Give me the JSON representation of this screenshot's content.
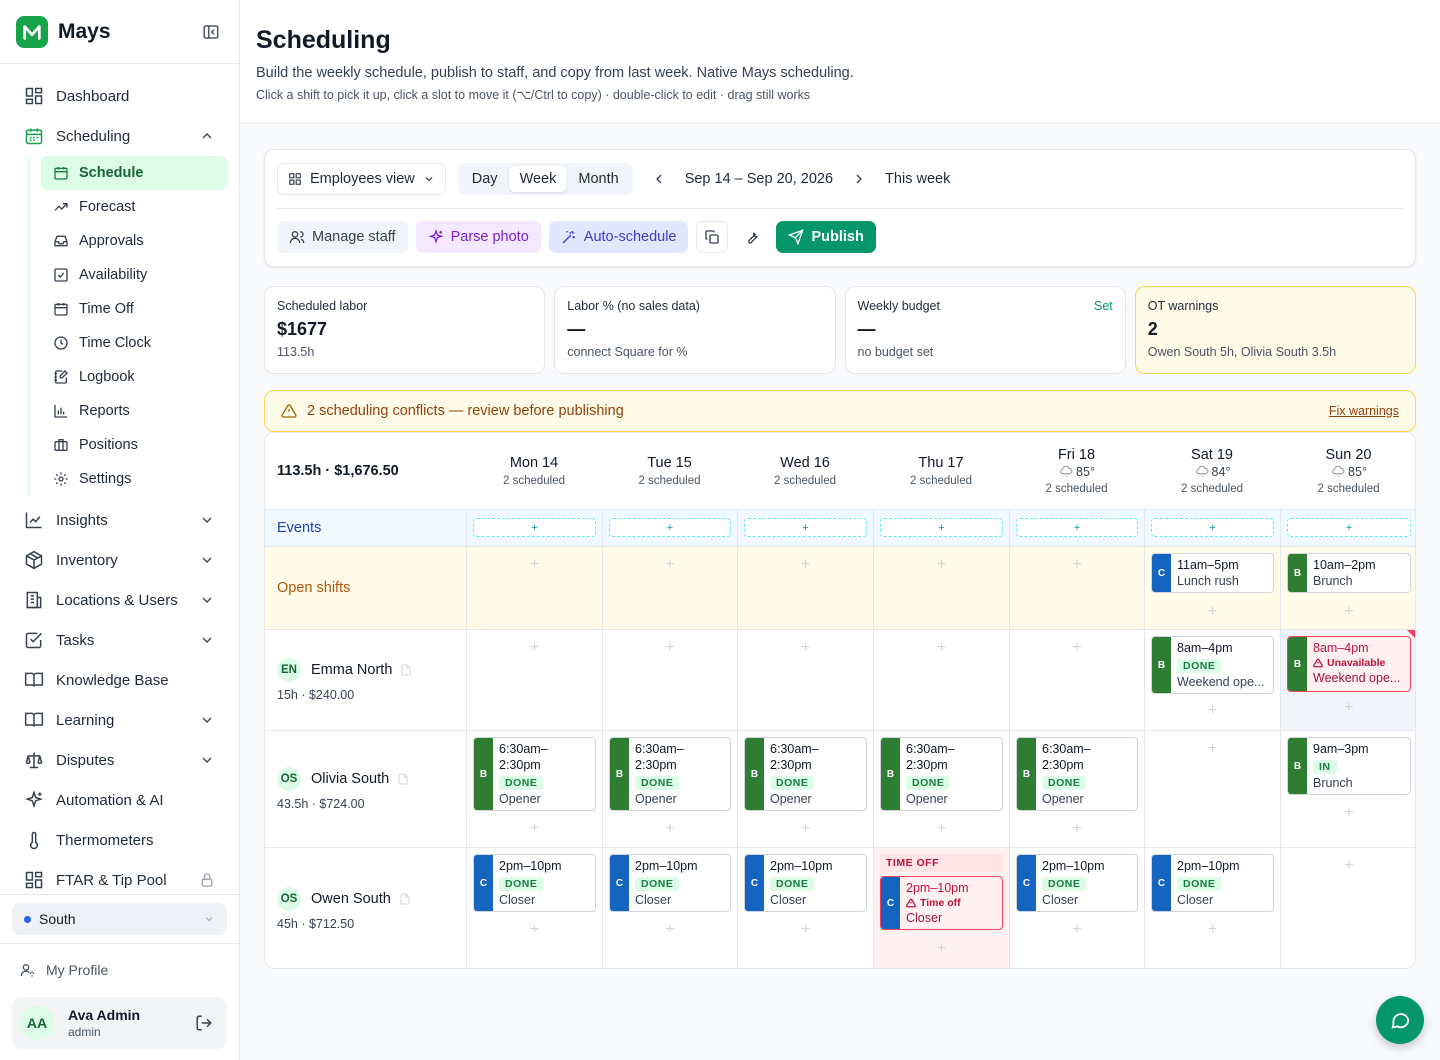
{
  "app": {
    "name": "Mays"
  },
  "sidebar": {
    "items": [
      {
        "label": "Dashboard"
      },
      {
        "label": "Scheduling"
      },
      {
        "label": "Insights"
      },
      {
        "label": "Inventory"
      },
      {
        "label": "Locations & Users"
      },
      {
        "label": "Tasks"
      },
      {
        "label": "Knowledge Base"
      },
      {
        "label": "Learning"
      },
      {
        "label": "Disputes"
      },
      {
        "label": "Automation & AI"
      },
      {
        "label": "Thermometers"
      },
      {
        "label": "FTAR & Tip Pool"
      }
    ],
    "scheduling_sub": [
      {
        "label": "Schedule"
      },
      {
        "label": "Forecast"
      },
      {
        "label": "Approvals"
      },
      {
        "label": "Availability"
      },
      {
        "label": "Time Off"
      },
      {
        "label": "Time Clock"
      },
      {
        "label": "Logbook"
      },
      {
        "label": "Reports"
      },
      {
        "label": "Positions"
      },
      {
        "label": "Settings"
      }
    ],
    "location": "South",
    "my_profile": "My Profile",
    "user": {
      "initials": "AA",
      "name": "Ava Admin",
      "role": "admin"
    }
  },
  "header": {
    "title": "Scheduling",
    "subtitle": "Build the weekly schedule, publish to staff, and copy from last week. Native Mays scheduling.",
    "hint": "Click a shift to pick it up, click a slot to move it (⌥/Ctrl to copy) · double-click to edit · drag still works"
  },
  "toolbar": {
    "view_select": "Employees view",
    "range_tabs": [
      "Day",
      "Week",
      "Month"
    ],
    "active_range": "Week",
    "date_range": "Sep 14 – Sep 20, 2026",
    "this_week": "This week",
    "manage_staff": "Manage staff",
    "parse_photo": "Parse photo",
    "auto_schedule": "Auto-schedule",
    "publish": "Publish"
  },
  "stats": [
    {
      "label": "Scheduled labor",
      "value": "$1677",
      "sub": "113.5h"
    },
    {
      "label": "Labor % (no sales data)",
      "value": "—",
      "sub": "connect Square for %"
    },
    {
      "label": "Weekly budget",
      "value": "—",
      "sub": "no budget set",
      "action": "Set"
    },
    {
      "label": "OT warnings",
      "value": "2",
      "sub": "Owen South 5h, Olivia South 3.5h"
    }
  ],
  "conflict": {
    "text": "2 scheduling conflicts — review before publishing",
    "link": "Fix warnings"
  },
  "grid": {
    "totals": "113.5h · $1,676.50",
    "days": [
      {
        "name": "Mon 14",
        "count": "2 scheduled"
      },
      {
        "name": "Tue 15",
        "count": "2 scheduled"
      },
      {
        "name": "Wed 16",
        "count": "2 scheduled"
      },
      {
        "name": "Thu 17",
        "count": "2 scheduled"
      },
      {
        "name": "Fri 18",
        "temp": "85°",
        "count": "2 scheduled"
      },
      {
        "name": "Sat 19",
        "temp": "84°",
        "count": "2 scheduled"
      },
      {
        "name": "Sun 20",
        "temp": "85°",
        "count": "2 scheduled"
      }
    ],
    "events_label": "Events",
    "event_add": "+",
    "open_label": "Open shifts",
    "open_shifts": [
      null,
      null,
      null,
      null,
      null,
      {
        "role": "C",
        "time": "11am–5pm",
        "position": "Lunch rush"
      },
      {
        "role": "B",
        "time": "10am–2pm",
        "position": "Brunch"
      }
    ],
    "employees": [
      {
        "initials": "EN",
        "name": "Emma North",
        "meta": "15h · $240.00",
        "shifts": [
          null,
          null,
          null,
          null,
          null,
          {
            "role": "B",
            "time": "8am–4pm",
            "badge": "DONE",
            "position": "Weekend ope..."
          },
          {
            "role": "B",
            "time": "8am–4pm",
            "warning": "Unavailable",
            "position": "Weekend ope..."
          }
        ]
      },
      {
        "initials": "OS",
        "name": "Olivia South",
        "meta": "43.5h · $724.00",
        "shifts": [
          {
            "role": "B",
            "time": "6:30am–2:30pm",
            "badge": "DONE",
            "position": "Opener"
          },
          {
            "role": "B",
            "time": "6:30am–2:30pm",
            "badge": "DONE",
            "position": "Opener"
          },
          {
            "role": "B",
            "time": "6:30am–2:30pm",
            "badge": "DONE",
            "position": "Opener"
          },
          {
            "role": "B",
            "time": "6:30am–2:30pm",
            "badge": "DONE",
            "position": "Opener"
          },
          {
            "role": "B",
            "time": "6:30am–2:30pm",
            "badge": "DONE",
            "position": "Opener"
          },
          null,
          {
            "role": "B",
            "time": "9am–3pm",
            "badge": "IN",
            "position": "Brunch"
          }
        ]
      },
      {
        "initials": "OS",
        "name": "Owen South",
        "meta": "45h · $712.50",
        "shifts": [
          {
            "role": "C",
            "time": "2pm–10pm",
            "badge": "DONE",
            "position": "Closer"
          },
          {
            "role": "C",
            "time": "2pm–10pm",
            "badge": "DONE",
            "position": "Closer"
          },
          {
            "role": "C",
            "time": "2pm–10pm",
            "badge": "DONE",
            "position": "Closer"
          },
          {
            "role": "C",
            "time": "2pm–10pm",
            "banner": "TIME OFF",
            "timeoff": "Time off",
            "position": "Closer"
          },
          {
            "role": "C",
            "time": "2pm–10pm",
            "badge": "DONE",
            "position": "Closer"
          },
          {
            "role": "C",
            "time": "2pm–10pm",
            "badge": "DONE",
            "position": "Closer"
          },
          null
        ]
      }
    ],
    "add_slot": "+"
  },
  "colors": {
    "accent": "#059669",
    "role_b": "#2e7d32",
    "role_c": "#1565c0",
    "warning": "#fcd34d",
    "danger": "#f43f5e"
  }
}
